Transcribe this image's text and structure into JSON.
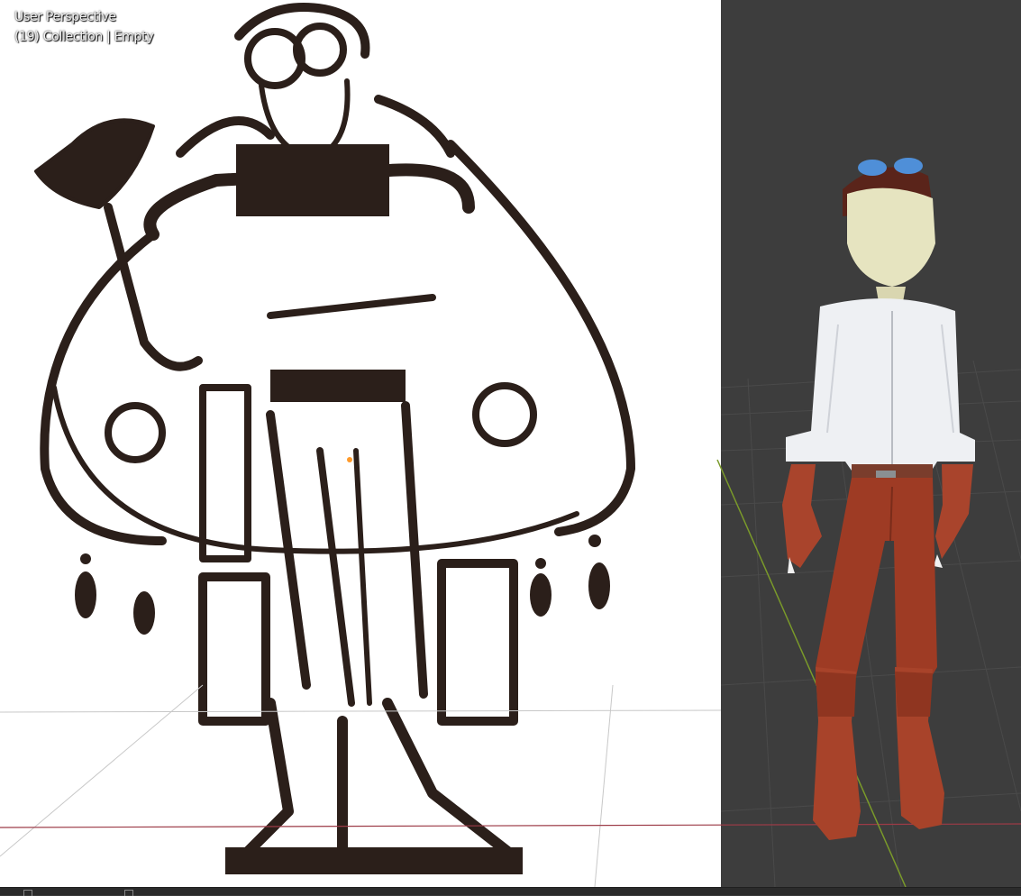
{
  "viewport": {
    "perspective_label": "User Perspective",
    "collection_label": "(19) Collection | Empty"
  },
  "colors": {
    "viewport_bg": "#3d3d3d",
    "grid_line": "#4a4a4a",
    "x_axis": "#9c3b47",
    "y_axis": "#7a9a2a",
    "origin_dot": "#ff9a2a",
    "ink": "#2b1f1a"
  },
  "icons": {
    "status_left": "square-icon",
    "status_right": "corner-icon"
  }
}
